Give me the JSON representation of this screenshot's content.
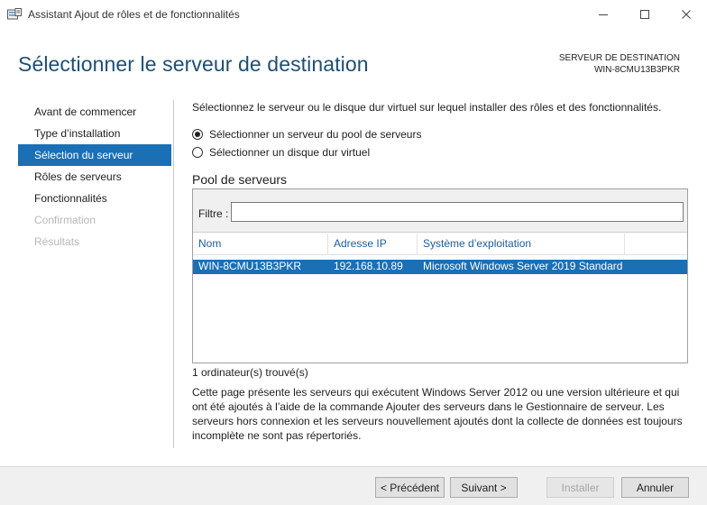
{
  "window": {
    "title": "Assistant Ajout de rôles et de fonctionnalités",
    "controls": [
      "minimize-icon",
      "maximize-icon",
      "close-icon"
    ]
  },
  "header": {
    "heading": "Sélectionner le serveur de destination",
    "destination_label": "SERVEUR DE DESTINATION",
    "destination_value": "WIN-8CMU13B3PKR"
  },
  "nav": {
    "items": [
      {
        "label": "Avant de commencer",
        "state": "normal"
      },
      {
        "label": "Type d’installation",
        "state": "normal"
      },
      {
        "label": "Sélection du serveur",
        "state": "selected"
      },
      {
        "label": "Rôles de serveurs",
        "state": "normal"
      },
      {
        "label": "Fonctionnalités",
        "state": "normal"
      },
      {
        "label": "Confirmation",
        "state": "disabled"
      },
      {
        "label": "Résultats",
        "state": "disabled"
      }
    ]
  },
  "content": {
    "intro": "Sélectionnez le serveur ou le disque dur virtuel sur lequel installer des rôles et des fonctionnalités.",
    "radio_pool": "Sélectionner un serveur du pool de serveurs",
    "radio_vhd": "Sélectionner un disque dur virtuel",
    "selected_option": "pool",
    "pool_title": "Pool de serveurs",
    "filter_label": "Filtre :",
    "filter_value": "",
    "columns": [
      "Nom",
      "Adresse IP",
      "Système d’exploitation"
    ],
    "rows": [
      {
        "name": "WIN-8CMU13B3PKR",
        "ip": "192.168.10.89",
        "os": "Microsoft Windows Server 2019 Standard"
      }
    ],
    "found": "1 ordinateur(s) trouvé(s)",
    "description": "Cette page présente les serveurs qui exécutent Windows Server 2012 ou une version ultérieure et qui ont été ajoutés à l’aide de la commande Ajouter des serveurs dans le Gestionnaire de serveur. Les serveurs hors connexion et les serveurs nouvellement ajoutés dont la collecte de données est toujours incomplète ne sont pas répertoriés."
  },
  "footer": {
    "previous": "< Précédent",
    "next": "Suivant >",
    "install": "Installer",
    "cancel": "Annuler"
  },
  "colors": {
    "heading": "#1e4f73",
    "selection": "#1a6fb5",
    "column_header": "#1c5e9c"
  }
}
